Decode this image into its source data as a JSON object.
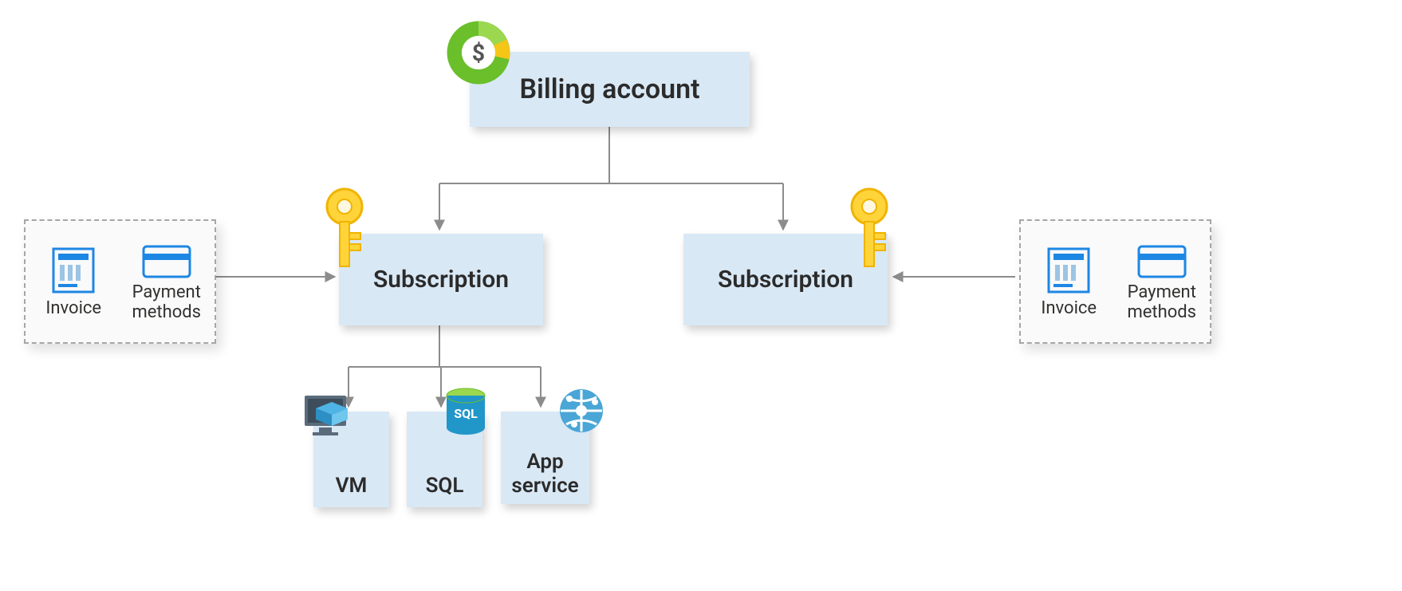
{
  "nodes": {
    "billing": {
      "label": "Billing account"
    },
    "subscription1": {
      "label": "Subscription"
    },
    "subscription2": {
      "label": "Subscription"
    },
    "vm": {
      "label": "VM"
    },
    "sql": {
      "label": "SQL"
    },
    "app": {
      "label": "App\nservice"
    }
  },
  "side": {
    "invoice": "Invoice",
    "payment_methods": "Payment\nmethods"
  },
  "icons": {
    "dollar": "$",
    "sql_tag": "SQL"
  }
}
